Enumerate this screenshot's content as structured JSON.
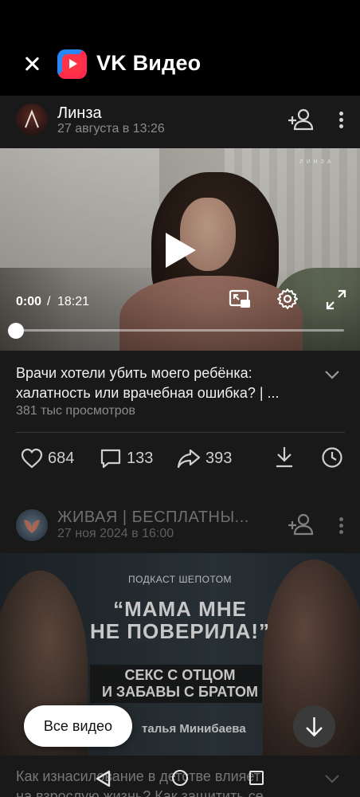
{
  "header": {
    "app_title": "VK Видео"
  },
  "post": {
    "channel_name": "Линза",
    "date": "27 августа в 13:26",
    "video": {
      "watermark": "ЛИНЗА",
      "time_current": "0:00",
      "time_separator": "/",
      "time_total": "18:21",
      "progress_fraction": 0.0
    },
    "title": "Врачи хотели убить моего ребёнка: халатность или врачебная ошибка? | ...",
    "views": "381 тыс просмотров",
    "actions": {
      "likes": "684",
      "comments": "133",
      "shares": "393"
    }
  },
  "post2": {
    "channel_name": "ЖИВАЯ | БЕСПЛАТНЫ...",
    "date": "27 ноя 2024 в 16:00",
    "thumbnail": {
      "small_caption": "ПОДКАСТ ШЕПОТОМ",
      "headline_line1": "“МАМА МНЕ",
      "headline_line2": "НЕ ПОВЕРИЛА!”",
      "sub_line1": "СЕКС С ОТЦОМ",
      "sub_line2": "И ЗАБАВЫ С БРАТОМ",
      "guest_name": "талья Минибаева"
    },
    "title_line1": "Как изнасилование в детстве влияет",
    "title_line2": "на взрослую жизнь? Как защитить се..."
  },
  "floating": {
    "all_videos_label": "Все видео"
  },
  "colors": {
    "background": "#191919",
    "header_bg": "#000000",
    "accent_red": "#ff3347",
    "accent_blue": "#2787f5",
    "muted_text": "#8b8b8b"
  },
  "icons": [
    "close-icon",
    "vk-video-logo",
    "add-friend-icon",
    "more-vertical-icon",
    "play-icon",
    "pip-icon",
    "settings-icon",
    "fullscreen-icon",
    "chevron-down-icon",
    "like-icon",
    "comment-icon",
    "share-icon",
    "download-icon",
    "watch-later-icon",
    "arrow-down-icon",
    "nav-back-icon",
    "nav-home-icon",
    "nav-recents-icon"
  ]
}
